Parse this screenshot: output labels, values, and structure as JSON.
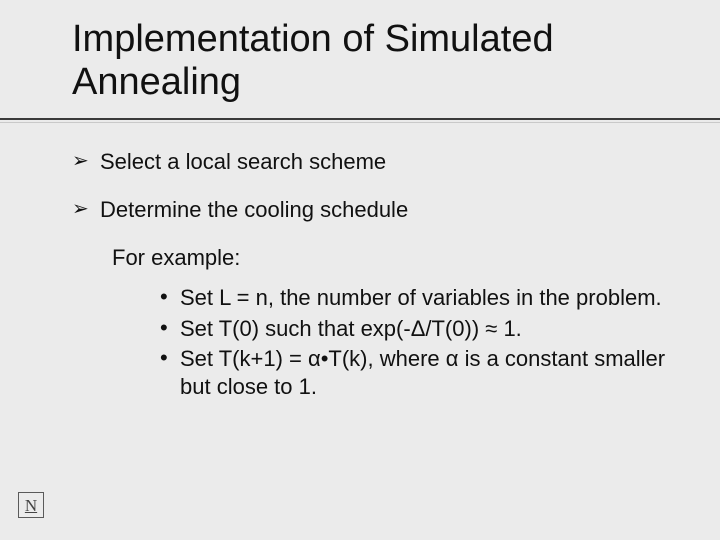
{
  "title": "Implementation of Simulated Annealing",
  "bullets": {
    "b1": "Select a local search scheme",
    "b2": "Determine the cooling schedule"
  },
  "example_label": "For example:",
  "sub": {
    "s1": "Set L = n, the number of variables in the problem.",
    "s2": "Set T(0) such that exp(-Δ/T(0)) ≈ 1.",
    "s3": "Set T(k+1) = α•T(k), where α is a constant smaller but close to 1."
  },
  "logo": "N"
}
